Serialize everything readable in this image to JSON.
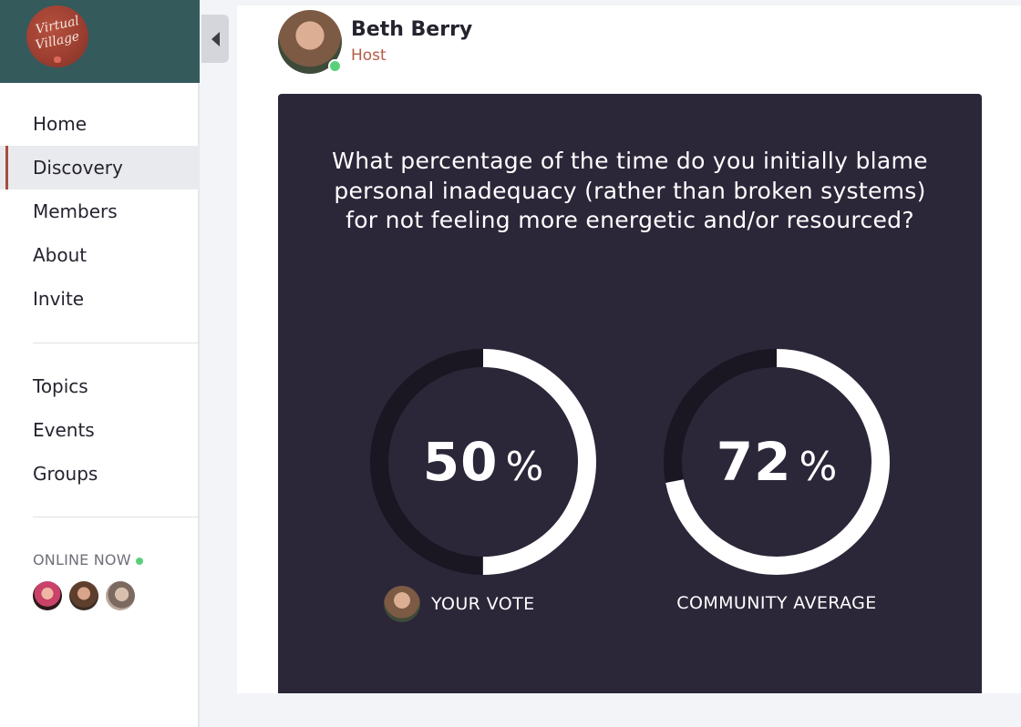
{
  "brand": {
    "logo_line1": "Virtual",
    "logo_line2": "Village",
    "colors": {
      "header": "#345a5c",
      "logo": "#9d3f31",
      "accent": "#a84c3f"
    }
  },
  "nav": {
    "primary": [
      {
        "label": "Home",
        "active": false
      },
      {
        "label": "Discovery",
        "active": true
      },
      {
        "label": "Members",
        "active": false
      },
      {
        "label": "About",
        "active": false
      },
      {
        "label": "Invite",
        "active": false
      }
    ],
    "secondary": [
      {
        "label": "Topics"
      },
      {
        "label": "Events"
      },
      {
        "label": "Groups"
      }
    ]
  },
  "online": {
    "label": "ONLINE NOW",
    "count_avatars": 3
  },
  "icons": {
    "collapse": "chevron-left-icon",
    "online_indicator": "green-dot"
  },
  "post": {
    "author_name": "Beth Berry",
    "author_role": "Host"
  },
  "poll": {
    "question": "What percentage of the time do you initially blame personal inadequacy (rather than broken systems) for not feeling more energetic and/or resourced?",
    "your_vote": {
      "value": "50",
      "unit": "%",
      "label": "YOUR VOTE",
      "fraction": 0.5
    },
    "community_average": {
      "value": "72",
      "unit": "%",
      "label": "COMMUNITY AVERAGE",
      "fraction": 0.72
    },
    "colors": {
      "background": "#2c2639",
      "track": "#1a1622",
      "fill": "#ffffff"
    }
  }
}
